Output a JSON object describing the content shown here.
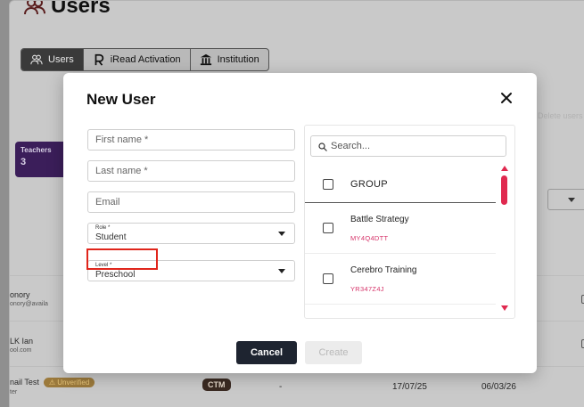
{
  "page": {
    "title": "Users",
    "tabs": [
      {
        "label": "Users",
        "icon": "users-icon",
        "active": true
      },
      {
        "label": "iRead Activation",
        "icon": "iread-icon",
        "active": false
      },
      {
        "label": "Institution",
        "icon": "institution-icon",
        "active": false
      }
    ],
    "teachers_card": {
      "label": "Teachers",
      "count": "3"
    },
    "delete_users_label": "Delete users",
    "rows": [
      {
        "name": "onory",
        "email": "onory@availa"
      },
      {
        "name": "LK Ian",
        "email": "ool.com"
      },
      {
        "name": "nail Test",
        "badge": "Unverified",
        "sub": "ter",
        "tag": "CTM",
        "dash": "-",
        "date1": "17/07/25",
        "date2": "06/03/26"
      }
    ]
  },
  "modal": {
    "title": "New User",
    "first_name_placeholder": "First name *",
    "last_name_placeholder": "Last name *",
    "email_placeholder": "Email",
    "role": {
      "label": "Role *",
      "value": "Student"
    },
    "level": {
      "label": "Level *",
      "value": "Preschool"
    },
    "search_placeholder": "Search...",
    "group_header": "GROUP",
    "groups": [
      {
        "name": "Battle Strategy",
        "code": "MY4Q4DTT"
      },
      {
        "name": "Cerebro Training",
        "code": "YR347Z4J"
      }
    ],
    "cancel_label": "Cancel",
    "create_label": "Create"
  },
  "colors": {
    "accent": "#e0294f",
    "code": "#d6346a",
    "primary_button": "#1e2430",
    "highlight": "#e0251b"
  }
}
